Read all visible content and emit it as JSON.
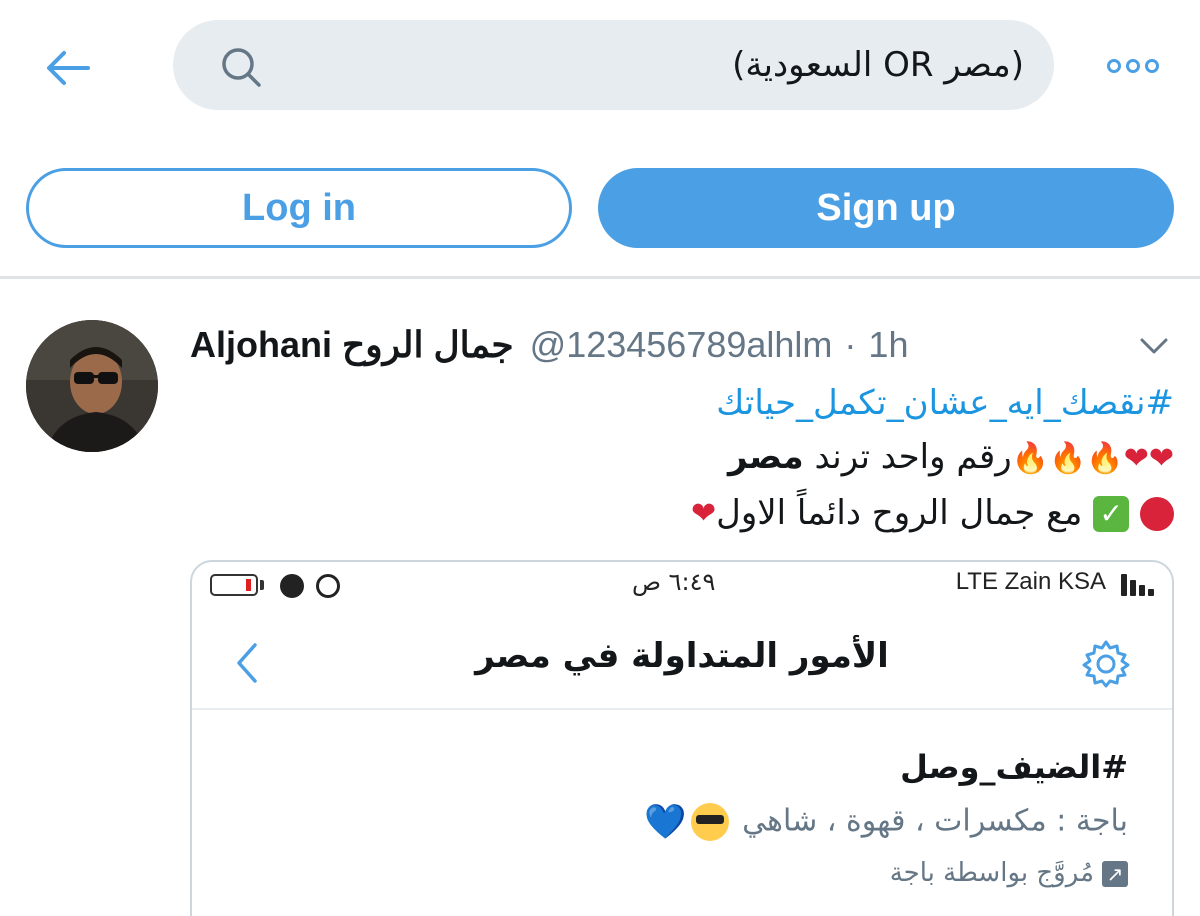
{
  "colors": {
    "accent": "#4a9fe5",
    "link": "#1b95e0",
    "muted": "#657786",
    "search_bg": "#e6ecf0"
  },
  "header": {
    "search_query": "(مصر OR السعودية)"
  },
  "auth": {
    "login_label": "Log in",
    "signup_label": "Sign up"
  },
  "tweet": {
    "display_name": "Aljohani جمال الروح",
    "handle": "@123456789alhlm",
    "separator": "·",
    "time": "1h",
    "hashtag": "#نقصك_ايه_عشان_تكمل_حياتك",
    "line1_text": "رقم واحد ترند ",
    "line1_bold": "مصر",
    "line2_text": "مع جمال الروح دائماً الاول",
    "heart": "❤",
    "fire": "🔥"
  },
  "media": {
    "status_time": "٦:٤٩ ص",
    "carrier": "LTE  Zain KSA",
    "title": "الأمور المتداولة في مصر",
    "trend_tag": "#الضيف_وصل",
    "trend_desc": "باجة : مكسرات ، قهوة ، شاهي",
    "blue_heart": "💙",
    "promoted": "مُروَّج بواسطة باجة",
    "promo_icon": "↗"
  }
}
